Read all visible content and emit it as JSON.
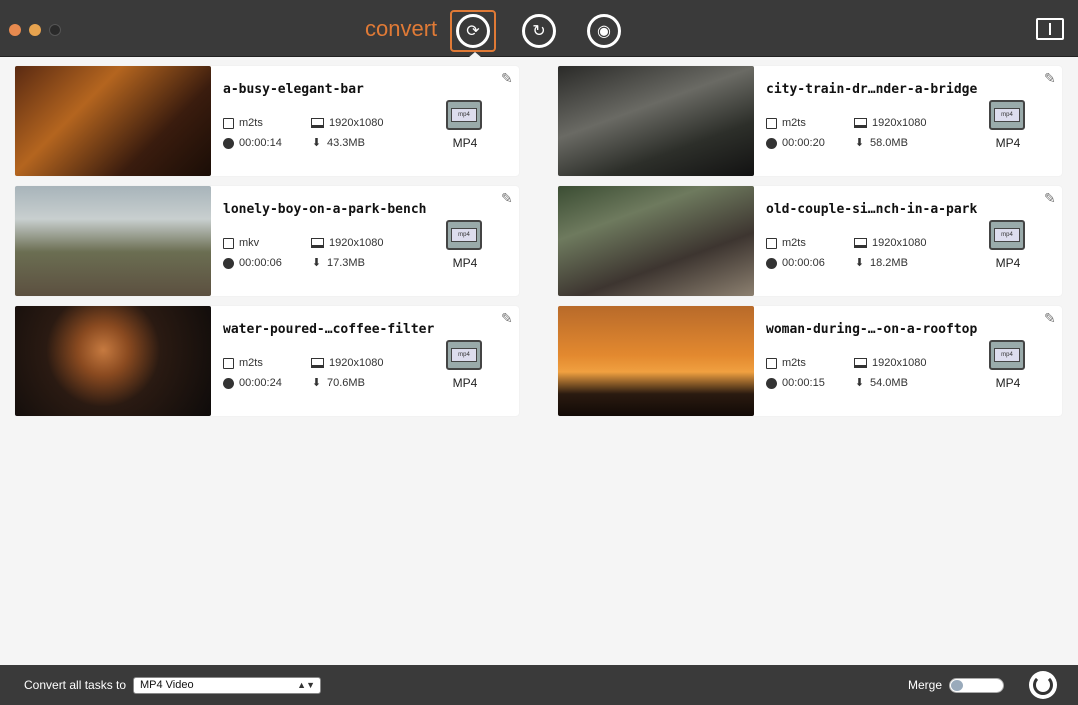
{
  "header": {
    "mode_label": "convert",
    "modes": [
      {
        "name": "convert",
        "icon": "convert-icon",
        "active": true
      },
      {
        "name": "rotate",
        "icon": "rotate-icon",
        "active": false
      },
      {
        "name": "media",
        "icon": "film-reel-icon",
        "active": false
      }
    ]
  },
  "tasks": [
    {
      "title": "a-busy-elegant-bar",
      "format": "m2ts",
      "resolution": "1920x1080",
      "duration": "00:00:14",
      "size": "43.3MB",
      "target": "MP4"
    },
    {
      "title": "city-train-dr…nder-a-bridge",
      "format": "m2ts",
      "resolution": "1920x1080",
      "duration": "00:00:20",
      "size": "58.0MB",
      "target": "MP4"
    },
    {
      "title": "lonely-boy-on-a-park-bench",
      "format": "mkv",
      "resolution": "1920x1080",
      "duration": "00:00:06",
      "size": "17.3MB",
      "target": "MP4"
    },
    {
      "title": "old-couple-si…nch-in-a-park",
      "format": "m2ts",
      "resolution": "1920x1080",
      "duration": "00:00:06",
      "size": "18.2MB",
      "target": "MP4"
    },
    {
      "title": "water-poured-…coffee-filter",
      "format": "m2ts",
      "resolution": "1920x1080",
      "duration": "00:00:24",
      "size": "70.6MB",
      "target": "MP4"
    },
    {
      "title": "woman-during-…-on-a-rooftop",
      "format": "m2ts",
      "resolution": "1920x1080",
      "duration": "00:00:15",
      "size": "54.0MB",
      "target": "MP4"
    }
  ],
  "footer": {
    "convert_all_label": "Convert all tasks to",
    "selected_format": "MP4 Video",
    "merge_label": "Merge",
    "merge_enabled": false
  },
  "colors": {
    "accent": "#e07a36",
    "bar": "#3a3a3a"
  }
}
